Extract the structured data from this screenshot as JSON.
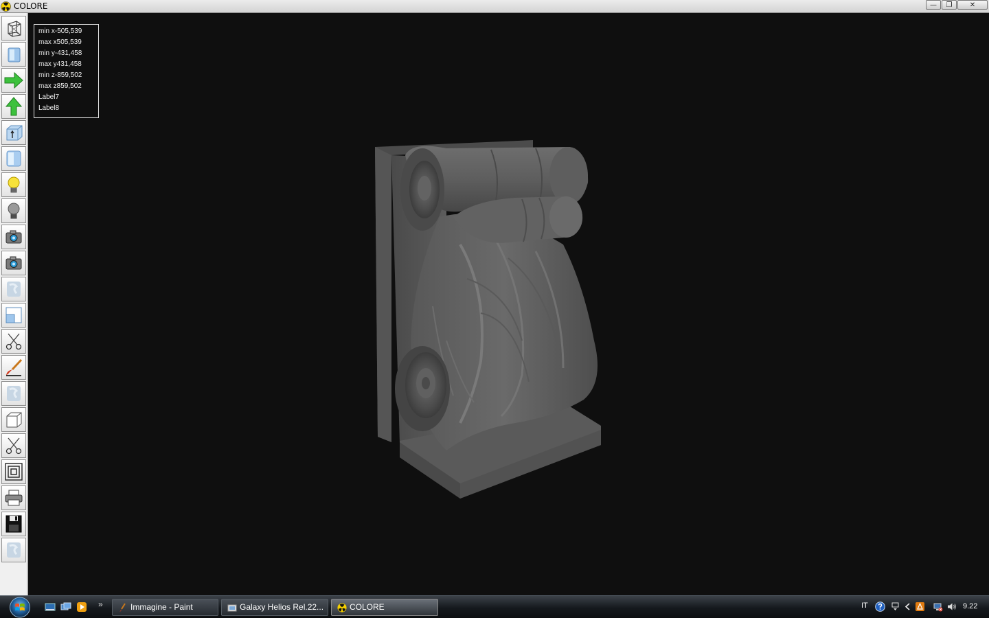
{
  "window": {
    "title": "COLORE",
    "minimize_glyph": "—",
    "restore_glyph": "❐",
    "close_glyph": "✕"
  },
  "toolbar": {
    "tools": [
      {
        "name": "wireframe-cube-icon"
      },
      {
        "name": "solid-cube-icon"
      },
      {
        "name": "arrow-right-icon"
      },
      {
        "name": "arrow-up-icon"
      },
      {
        "name": "axis-box-icon"
      },
      {
        "name": "blue-panel-icon"
      },
      {
        "name": "light-bulb-on-icon"
      },
      {
        "name": "light-bulb-off-icon"
      },
      {
        "name": "camera-icon"
      },
      {
        "name": "camera-2-icon"
      },
      {
        "name": "texture-disabled-icon"
      },
      {
        "name": "split-view-icon"
      },
      {
        "name": "scissors-icon"
      },
      {
        "name": "paint-brush-icon"
      },
      {
        "name": "texture-disabled-2-icon"
      },
      {
        "name": "box-outline-icon"
      },
      {
        "name": "scissors-2-icon"
      },
      {
        "name": "concentric-squares-icon"
      },
      {
        "name": "printer-icon"
      },
      {
        "name": "floppy-disk-icon"
      },
      {
        "name": "texture-disabled-3-icon"
      }
    ]
  },
  "info": {
    "rows": [
      "min x-505,539",
      "max x505,539",
      "min y-431,458",
      "max y431,458",
      "min z-859,502",
      "max z859,502",
      "Label7",
      "Label8"
    ]
  },
  "taskbar": {
    "tasks": [
      {
        "label": "Immagine - Paint"
      },
      {
        "label": "Galaxy Helios  Rel.22..."
      },
      {
        "label": "COLORE"
      }
    ],
    "chevron": "»",
    "language": "IT",
    "clock": "9.22"
  },
  "colors": {
    "viewport_bg": "#0f0f0f",
    "model": "#5c5c5c",
    "taskbar": "#1a1e22"
  }
}
